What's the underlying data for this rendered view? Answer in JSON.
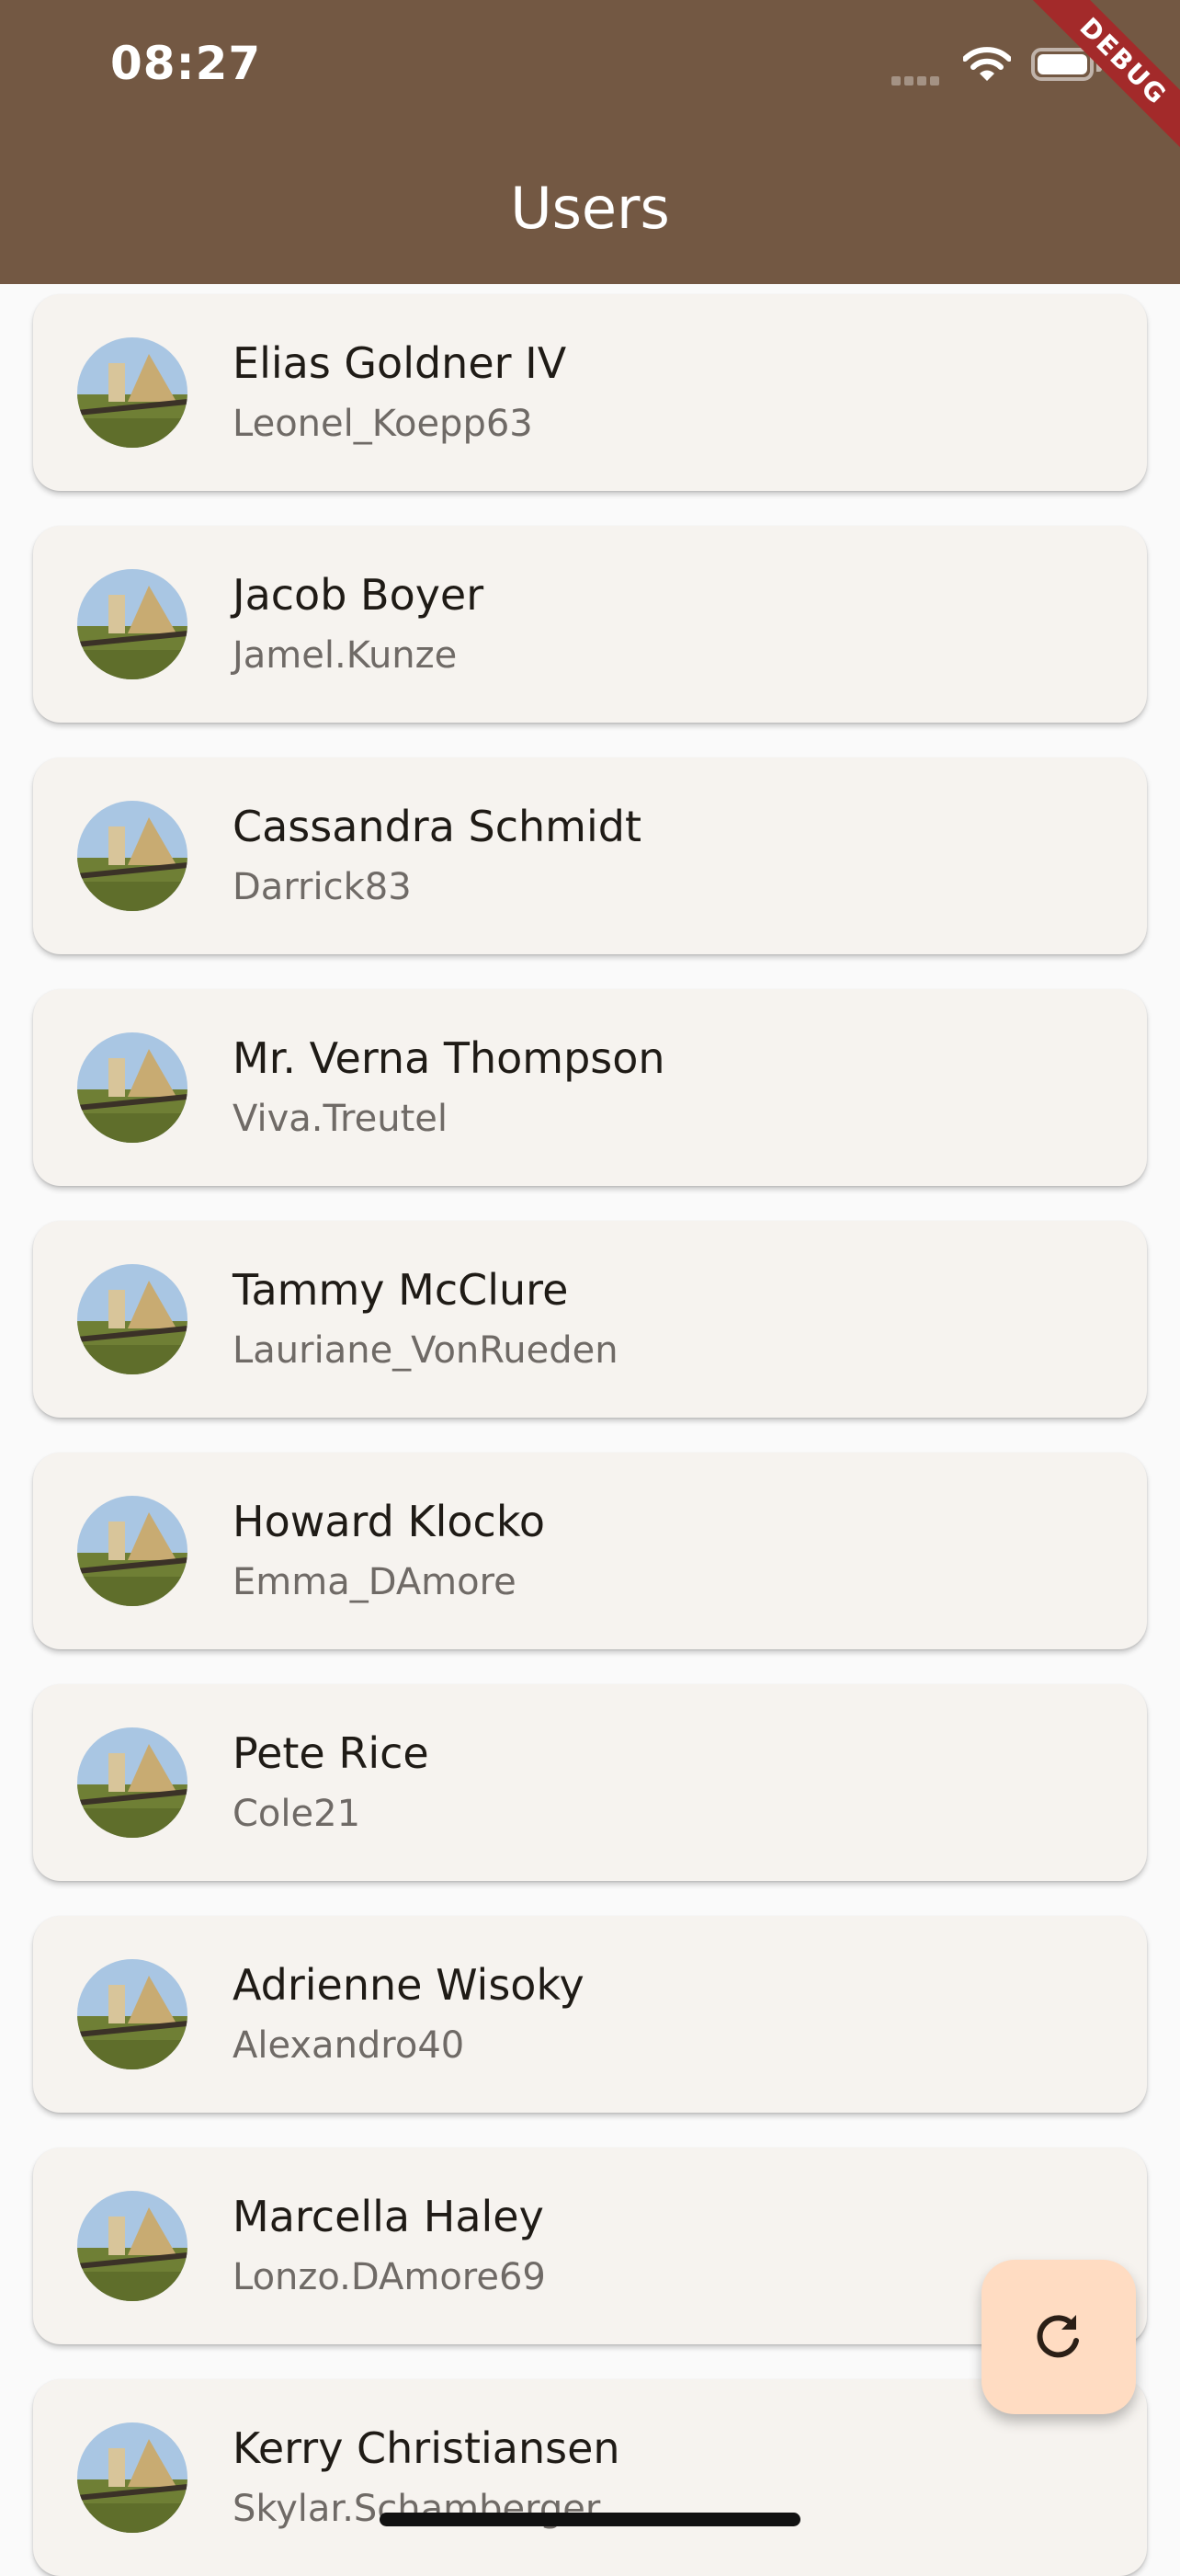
{
  "status_bar": {
    "time": "08:27"
  },
  "debug_banner": "DEBUG",
  "appbar": {
    "title": "Users"
  },
  "users": [
    {
      "name": "Elias Goldner IV",
      "username": "Leonel_Koepp63"
    },
    {
      "name": "Jacob Boyer",
      "username": "Jamel.Kunze"
    },
    {
      "name": "Cassandra Schmidt",
      "username": "Darrick83"
    },
    {
      "name": "Mr. Verna Thompson",
      "username": "Viva.Treutel"
    },
    {
      "name": "Tammy McClure",
      "username": "Lauriane_VonRueden"
    },
    {
      "name": "Howard Klocko",
      "username": "Emma_DAmore"
    },
    {
      "name": "Pete Rice",
      "username": "Cole21"
    },
    {
      "name": "Adrienne Wisoky",
      "username": "Alexandro40"
    },
    {
      "name": "Marcella Haley",
      "username": "Lonzo.DAmore69"
    },
    {
      "name": "Kerry Christiansen",
      "username": "Skylar.Schamberger"
    }
  ],
  "fab": {
    "icon": "refresh-icon"
  },
  "colors": {
    "appbar": "#735843",
    "card": "#f6f3ef",
    "fab": "#ffdcc2",
    "debug": "#a32a2a"
  }
}
